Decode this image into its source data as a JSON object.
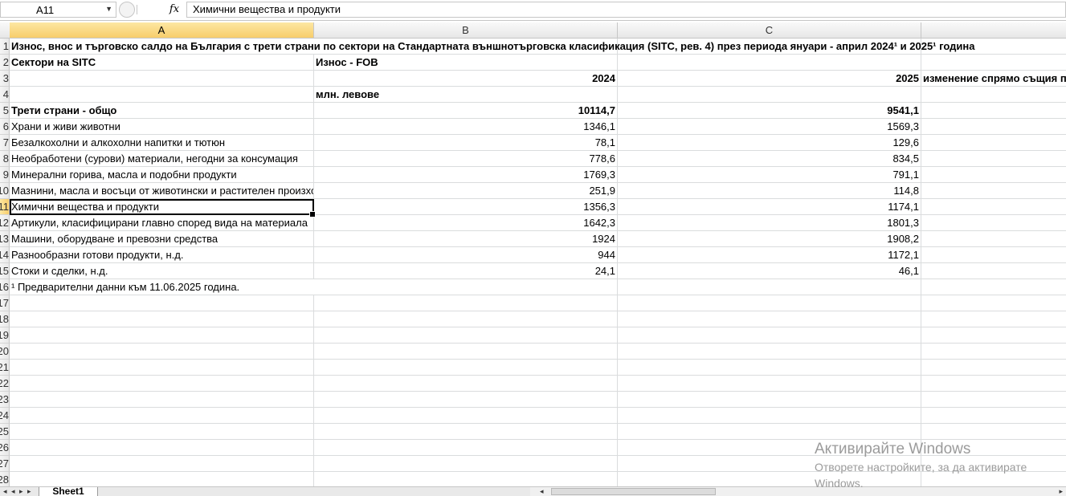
{
  "formula_bar": {
    "name_box": "A11",
    "fx_label": "fx",
    "content": "Химични вещества и продукти"
  },
  "columns": [
    "A",
    "B",
    "C"
  ],
  "rows": [
    {
      "num": "1",
      "a": "Износ, внос и търговско салдо на България с трети страни по сектори на Стандартната външнотърговска класификация (SITC, рев. 4) през периода януари - април 2024¹ и 2025¹ година",
      "b": "",
      "c": "",
      "d": ""
    },
    {
      "num": "2",
      "a": "Сектори на SITC",
      "b": "Износ - FOB",
      "c": "",
      "d": ""
    },
    {
      "num": "3",
      "a": "",
      "b": "2024",
      "c": "2025",
      "d": "изменение спрямо същия п"
    },
    {
      "num": "4",
      "a": "",
      "b": "млн. левове",
      "c": "",
      "d": ""
    },
    {
      "num": "5",
      "a": "Трети страни - общо",
      "b": "10114,7",
      "c": "9541,1",
      "d": ""
    },
    {
      "num": "6",
      "a": "Храни и живи животни",
      "b": "1346,1",
      "c": "1569,3",
      "d": ""
    },
    {
      "num": "7",
      "a": "Безалкохолни и алкохолни напитки и тютюн",
      "b": "78,1",
      "c": "129,6",
      "d": ""
    },
    {
      "num": "8",
      "a": "Необработени (сурови) материали, негодни за консумация",
      "b": "778,6",
      "c": "834,5",
      "d": ""
    },
    {
      "num": "9",
      "a": "Минерални горива, масла и подобни продукти",
      "b": "1769,3",
      "c": "791,1",
      "d": ""
    },
    {
      "num": "10",
      "a": "Мазнини, масла и восъци от животински и растителен произход",
      "b": "251,9",
      "c": "114,8",
      "d": ""
    },
    {
      "num": "11",
      "a": "Химични вещества и продукти",
      "b": "1356,3",
      "c": "1174,1",
      "d": ""
    },
    {
      "num": "12",
      "a": "Артикули, класифицирани главно според вида на материала",
      "b": "1642,3",
      "c": "1801,3",
      "d": ""
    },
    {
      "num": "13",
      "a": "Машини, оборудване и превозни средства",
      "b": "1924",
      "c": "1908,2",
      "d": ""
    },
    {
      "num": "14",
      "a": "Разнообразни готови продукти, н.д.",
      "b": "944",
      "c": "1172,1",
      "d": ""
    },
    {
      "num": "15",
      "a": "Стоки и сделки, н.д.",
      "b": "24,1",
      "c": "46,1",
      "d": ""
    },
    {
      "num": "16",
      "a": "¹ Предварителни данни към 11.06.2025 година.",
      "b": "",
      "c": "",
      "d": ""
    },
    {
      "num": "17",
      "a": "",
      "b": "",
      "c": "",
      "d": ""
    },
    {
      "num": "18",
      "a": "",
      "b": "",
      "c": "",
      "d": ""
    },
    {
      "num": "19",
      "a": "",
      "b": "",
      "c": "",
      "d": ""
    },
    {
      "num": "20",
      "a": "",
      "b": "",
      "c": "",
      "d": ""
    },
    {
      "num": "21",
      "a": "",
      "b": "",
      "c": "",
      "d": ""
    },
    {
      "num": "22",
      "a": "",
      "b": "",
      "c": "",
      "d": ""
    },
    {
      "num": "23",
      "a": "",
      "b": "",
      "c": "",
      "d": ""
    },
    {
      "num": "24",
      "a": "",
      "b": "",
      "c": "",
      "d": ""
    },
    {
      "num": "25",
      "a": "",
      "b": "",
      "c": "",
      "d": ""
    },
    {
      "num": "26",
      "a": "",
      "b": "",
      "c": "",
      "d": ""
    },
    {
      "num": "27",
      "a": "",
      "b": "",
      "c": "",
      "d": ""
    },
    {
      "num": "28",
      "a": "",
      "b": "",
      "c": "",
      "d": ""
    }
  ],
  "sheet_tab": "Sheet1",
  "watermark": {
    "line1": "Активирайте Windows",
    "line2": "Отворете настройките, за да активирате",
    "line3": "Windows."
  }
}
